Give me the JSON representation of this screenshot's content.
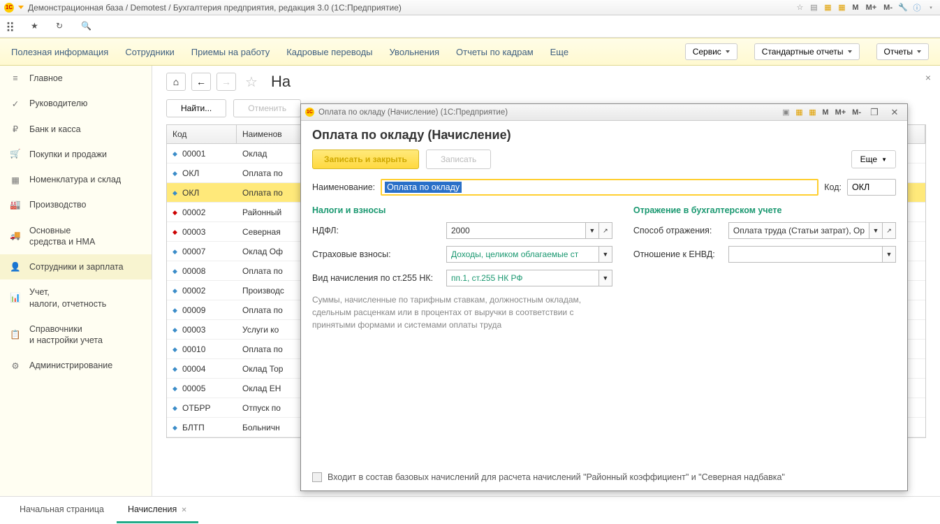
{
  "title": "Демонстрационная база / Demotest / Бухгалтерия предприятия, редакция 3.0  (1С:Предприятие)",
  "title_m": [
    "M",
    "M+",
    "M-"
  ],
  "menu": {
    "items": [
      "Полезная информация",
      "Сотрудники",
      "Приемы на работу",
      "Кадровые переводы",
      "Увольнения",
      "Отчеты по кадрам"
    ],
    "more": "Еще",
    "buttons": [
      "Сервис",
      "Стандартные отчеты",
      "Отчеты"
    ]
  },
  "sidebar": [
    {
      "icon": "≡",
      "label": "Главное"
    },
    {
      "icon": "✓",
      "label": "Руководителю"
    },
    {
      "icon": "₽",
      "label": "Банк и касса"
    },
    {
      "icon": "🛒",
      "label": "Покупки и продажи"
    },
    {
      "icon": "▦",
      "label": "Номенклатура и склад"
    },
    {
      "icon": "🏭",
      "label": "Производство"
    },
    {
      "icon": "🚚",
      "label": "Основные\nсредства и НМА"
    },
    {
      "icon": "👤",
      "label": "Сотрудники и зарплата"
    },
    {
      "icon": "📊",
      "label": "Учет,\nналоги, отчетность"
    },
    {
      "icon": "📋",
      "label": "Справочники\nи настройки учета"
    },
    {
      "icon": "⚙",
      "label": "Администрирование"
    }
  ],
  "sidebar_active": 7,
  "page_title": "На",
  "find_btn": "Найти...",
  "cancel_btn": "Отменить",
  "table": {
    "head": [
      "Код",
      "Наименов"
    ],
    "rows": [
      {
        "ic": "b",
        "code": "00001",
        "name": "Оклад"
      },
      {
        "ic": "b",
        "code": "ОКЛ",
        "name": "Оплата по"
      },
      {
        "ic": "b",
        "code": "ОКЛ",
        "name": "Оплата по",
        "sel": true
      },
      {
        "ic": "r",
        "code": "00002",
        "name": "Районный"
      },
      {
        "ic": "r",
        "code": "00003",
        "name": "Северная"
      },
      {
        "ic": "b",
        "code": "00007",
        "name": "Оклад Оф"
      },
      {
        "ic": "b",
        "code": "00008",
        "name": "Оплата по"
      },
      {
        "ic": "b",
        "code": "00002",
        "name": "Производс"
      },
      {
        "ic": "b",
        "code": "00009",
        "name": "Оплата по"
      },
      {
        "ic": "b",
        "code": "00003",
        "name": "Услуги ко"
      },
      {
        "ic": "b",
        "code": "00010",
        "name": "Оплата по"
      },
      {
        "ic": "b",
        "code": "00004",
        "name": "Оклад Тор"
      },
      {
        "ic": "b",
        "code": "00005",
        "name": "Оклад ЕН"
      },
      {
        "ic": "b",
        "code": "ОТБРР",
        "name": "Отпуск по"
      },
      {
        "ic": "b",
        "code": "БЛТП",
        "name": "Больничн"
      }
    ]
  },
  "tabs": [
    {
      "label": "Начальная страница",
      "close": false,
      "active": false
    },
    {
      "label": "Начисления",
      "close": true,
      "active": true
    }
  ],
  "dialog": {
    "title": "Оплата по окладу (Начисление) (1С:Предприятие)",
    "m": [
      "M",
      "M+",
      "M-"
    ],
    "header": "Оплата по окладу (Начисление)",
    "save_close": "Записать и закрыть",
    "save": "Записать",
    "more": "Еще",
    "name_lbl": "Наименование:",
    "name_val": "Оплата по окладу",
    "code_lbl": "Код:",
    "code_val": "ОКЛ",
    "sec_tax": "Налоги и взносы",
    "sec_acc": "Отражение в бухгалтерском учете",
    "ndfl_lbl": "НДФЛ:",
    "ndfl_val": "2000",
    "ins_lbl": "Страховые взносы:",
    "ins_val": "Доходы, целиком облагаемые ст",
    "kind_lbl": "Вид начисления по ст.255 НК:",
    "kind_val": "пп.1, ст.255 НК РФ",
    "refl_lbl": "Способ отражения:",
    "refl_val": "Оплата труда (Статьи затрат), Ор",
    "envd_lbl": "Отношение к ЕНВД:",
    "envd_val": "",
    "note": "Суммы, начисленные по тарифным ставкам, должностным окладам, сдельным расценкам или в процентах от выручки в соответствии с принятыми формами и системами оплаты труда",
    "chk_label": "Входит в состав базовых начислений для расчета начислений \"Районный коэффициент\" и \"Северная надбавка\""
  }
}
